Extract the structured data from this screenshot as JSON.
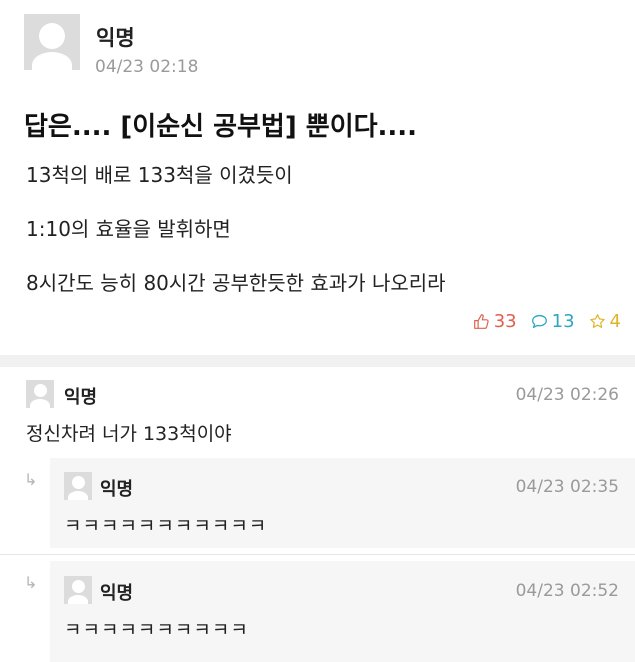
{
  "post": {
    "author": "익명",
    "time": "04/23 02:18",
    "title": "답은.... [이순신 공부법] 뿐이다....",
    "lines": [
      "13척의 배로 133척을 이겼듯이",
      "1:10의 효율을 발휘하면",
      "8시간도 능히 80시간 공부한듯한 효과가 나오리라"
    ],
    "likes": "33",
    "comments": "13",
    "scraps": "4"
  },
  "comments": [
    {
      "author": "익명",
      "time": "04/23 02:26",
      "text": "정신차려 너가 133척이야"
    }
  ],
  "replies": [
    {
      "author": "익명",
      "time": "04/23 02:35",
      "text": "ㅋㅋㅋㅋㅋㅋㅋㅋㅋㅋㅋ"
    },
    {
      "author": "익명",
      "time": "04/23 02:52",
      "text": "ㅋㅋㅋㅋㅋㅋㅋㅋㅋㅋ"
    }
  ],
  "colors": {
    "like": "#e0604f",
    "comment": "#2aa7c1",
    "scrap": "#e2b329"
  },
  "icons": [
    "avatar-icon",
    "thumbs-up-icon",
    "comment-bubble-icon",
    "star-icon",
    "reply-arrow-icon"
  ]
}
